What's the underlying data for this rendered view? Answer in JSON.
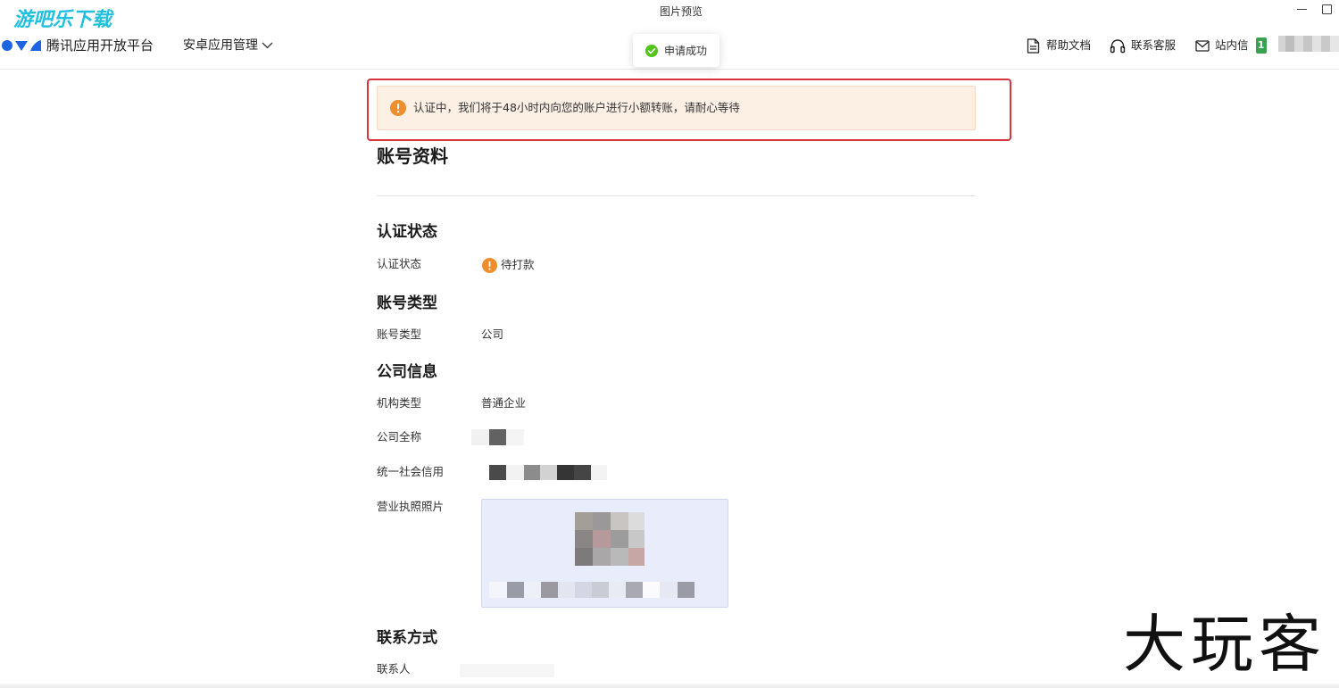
{
  "window": {
    "title": "图片预览"
  },
  "watermarks": {
    "top_left": "游吧乐下载",
    "bottom_right": "大玩客"
  },
  "header": {
    "brand": "腾讯应用开放平台",
    "nav_menu": {
      "label": "安卓应用管理",
      "icon": "chevron-down-icon"
    },
    "links": [
      {
        "label": "帮助文档",
        "icon": "document-icon"
      },
      {
        "label": "联系客服",
        "icon": "headset-icon"
      },
      {
        "label": "站内信",
        "icon": "mail-icon",
        "badge": "1"
      }
    ]
  },
  "toast": {
    "message": "申请成功",
    "icon": "check-circle-icon"
  },
  "alert": {
    "message": "认证中，我们将于48小时内向您的账户进行小额转账，请耐心等待",
    "icon": "warning-icon"
  },
  "page": {
    "title": "账号资料",
    "sections": [
      {
        "title": "认证状态",
        "fields": [
          {
            "label": "认证状态",
            "value": "待打款",
            "icon": "warning-icon"
          }
        ]
      },
      {
        "title": "账号类型",
        "fields": [
          {
            "label": "账号类型",
            "value": "公司"
          }
        ]
      },
      {
        "title": "公司信息",
        "fields": [
          {
            "label": "机构类型",
            "value": "普通企业"
          },
          {
            "label": "公司全称"
          },
          {
            "label": "统一社会信用"
          },
          {
            "label": "营业执照照片"
          }
        ]
      },
      {
        "title": "联系方式",
        "fields": [
          {
            "label": "联系人"
          }
        ]
      }
    ]
  },
  "colors": {
    "highlight_border": "#d8343c",
    "warning": "#ef8e2c",
    "success": "#52c41a",
    "badge": "#3aa150",
    "brand_blue": "#1e63e0",
    "alert_background": "#fcefe4"
  }
}
